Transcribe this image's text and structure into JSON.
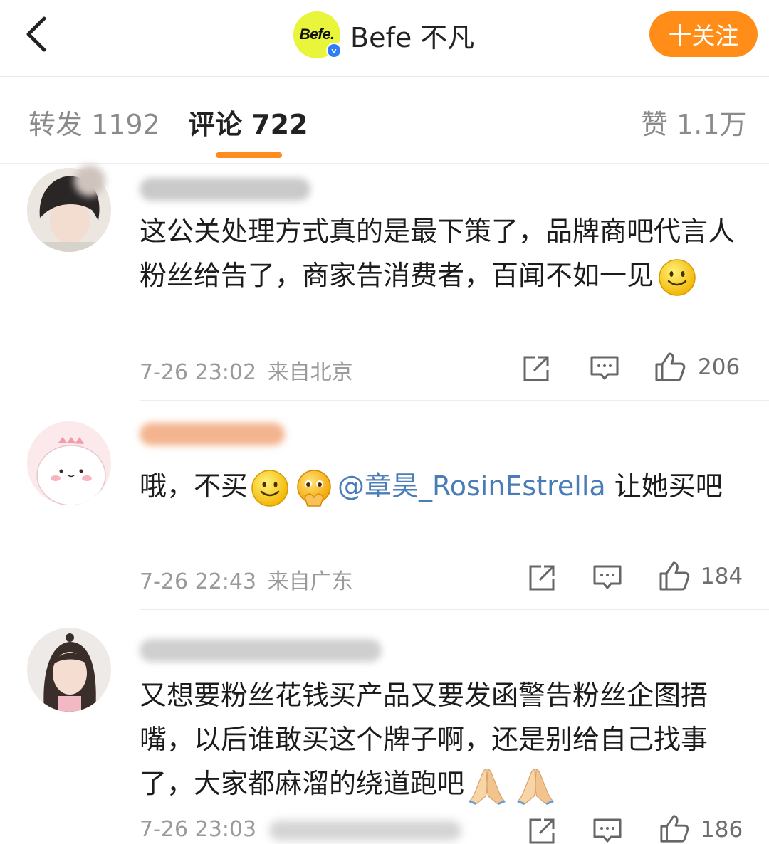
{
  "header": {
    "back_icon": "chevron-left-icon",
    "brand_logo_text": "Befe.",
    "brand_name": "Befe 不凡",
    "follow_label": "十关注",
    "accent": "#ff8d18",
    "logo_color": "#e8f53a",
    "verified_icon": "verified-badge-icon",
    "verified_mark": "v"
  },
  "tabs": {
    "repost": "转发 1192",
    "comments": "评论 722",
    "likes": "赞 1.1万"
  },
  "comments": [
    {
      "text": "这公关处理方式真的是最下策了，品牌商吧代言人粉丝给告了，商家告消费者，百闻不如一见",
      "emojis": [
        "smile-emoji-icon"
      ],
      "time": "7-26 23:02",
      "location": "来自北京",
      "likes": "206"
    },
    {
      "text_before": "哦，不买",
      "emojis": [
        "smile-emoji-icon",
        "pleading-emoji-icon"
      ],
      "mention": "@章昊_RosinEstrella",
      "text_after": " 让她买吧",
      "time": "7-26 22:43",
      "location": "来自广东",
      "likes": "184"
    },
    {
      "text": "又想要粉丝花钱买产品又要发函警告粉丝企图捂嘴，以后谁敢买这个牌子啊，还是别给自己找事了，大家都麻溜的绕道跑吧",
      "emojis": [
        "pray-hands-icon",
        "pray-hands-icon"
      ],
      "time": "7-26 23:03",
      "likes": "186"
    }
  ],
  "icons": {
    "share": "share-icon",
    "reply": "comment-icon",
    "like": "thumbs-up-icon"
  },
  "colors": {
    "mention": "#4a7cb8",
    "tab_indicator": "#ff8a1f",
    "meta_text": "#9a9a9a"
  }
}
